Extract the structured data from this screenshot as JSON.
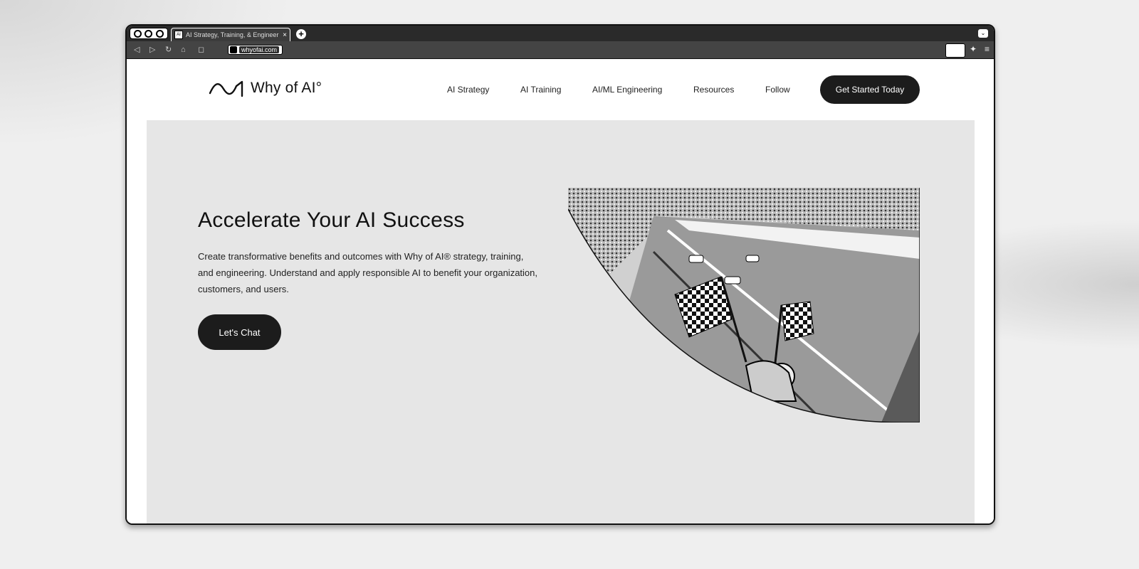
{
  "browser": {
    "tab_title": "AI Strategy, Training, & Engineer",
    "tab_favicon": "AI",
    "url_domain": "whyofai.com",
    "colors": {
      "chrome_dark": "#2a2a2a",
      "chrome_toolbar": "#444444"
    }
  },
  "site": {
    "logo_text": "Why of AI°",
    "nav": [
      "AI Strategy",
      "AI Training",
      "AI/ML Engineering",
      "Resources",
      "Follow"
    ],
    "cta_label": "Get Started Today",
    "accent": "#1c1c1c"
  },
  "hero": {
    "title": "Accelerate Your AI Success",
    "description": "Create transformative benefits and outcomes with Why of AI® strategy, training, and engineering.  Understand and apply responsible AI to benefit your organization, customers, and users.",
    "button_label": "Let's Chat",
    "image_subject": "racing finish line with checkered flags"
  }
}
